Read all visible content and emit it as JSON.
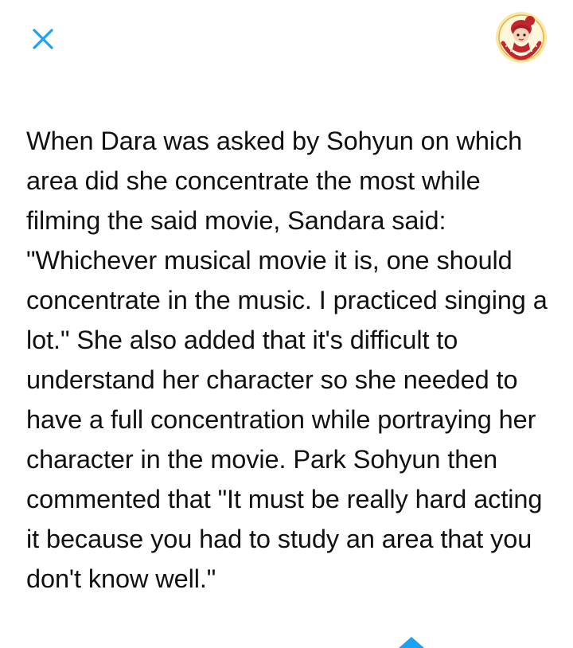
{
  "header": {
    "close_icon": "close-icon",
    "avatar_icon": "avatar-logo",
    "accent_color": "#1da1f2"
  },
  "article": {
    "body": "When Dara was asked by Sohyun on which area did she concentrate the most while filming the said movie, Sandara said: \"Whichever musical movie it is, one should concentrate in the music. I practiced singing a lot.\" She also added that it's difficult to understand her character so she needed to have a full concentration while portraying her character in the movie. Park Sohyun then commented that \"It must be really hard acting it because you had to study an area that you don't know well.\""
  },
  "footer": {
    "scroll_icon": "chevron-up-icon",
    "indicator_color": "#1da1f2"
  }
}
